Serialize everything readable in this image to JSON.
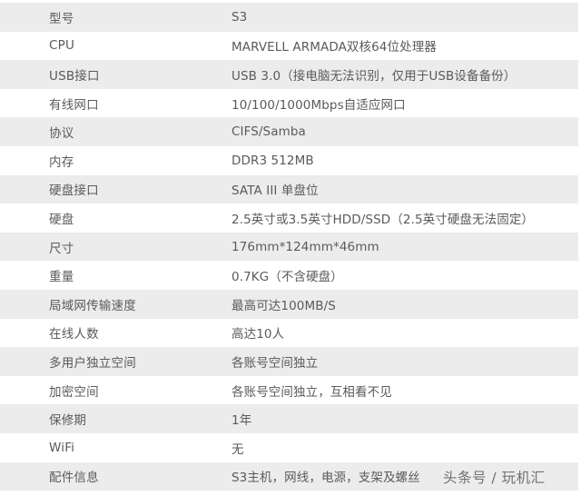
{
  "spec_table": {
    "rows": [
      {
        "label": "型号",
        "value": "S3"
      },
      {
        "label": "CPU",
        "value": "MARVELL ARMADA双核64位处理器"
      },
      {
        "label": "USB接口",
        "value": "USB 3.0（接电脑无法识别，仅用于USB设备备份）"
      },
      {
        "label": "有线网口",
        "value": "10/100/1000Mbps自适应网口"
      },
      {
        "label": "协议",
        "value": "CIFS/Samba"
      },
      {
        "label": "内存",
        "value": "DDR3 512MB"
      },
      {
        "label": "硬盘接口",
        "value": "SATA III 单盘位"
      },
      {
        "label": "硬盘",
        "value": "2.5英寸或3.5英寸HDD/SSD（2.5英寸硬盘无法固定）"
      },
      {
        "label": "尺寸",
        "value": "176mm*124mm*46mm"
      },
      {
        "label": "重量",
        "value": "0.7KG（不含硬盘）"
      },
      {
        "label": "局域网传输速度",
        "value": "最高可达100MB/S"
      },
      {
        "label": "在线人数",
        "value": "高达10人"
      },
      {
        "label": "多用户独立空间",
        "value": "各账号空间独立"
      },
      {
        "label": "加密空间",
        "value": "各账号空间独立，互相看不见"
      },
      {
        "label": "保修期",
        "value": "1年"
      },
      {
        "label": "WiFi",
        "value": "无"
      },
      {
        "label": "配件信息",
        "value": "S3主机，网线，电源，支架及螺丝"
      }
    ]
  },
  "watermark": {
    "text": "头条号 / 玩机汇"
  }
}
